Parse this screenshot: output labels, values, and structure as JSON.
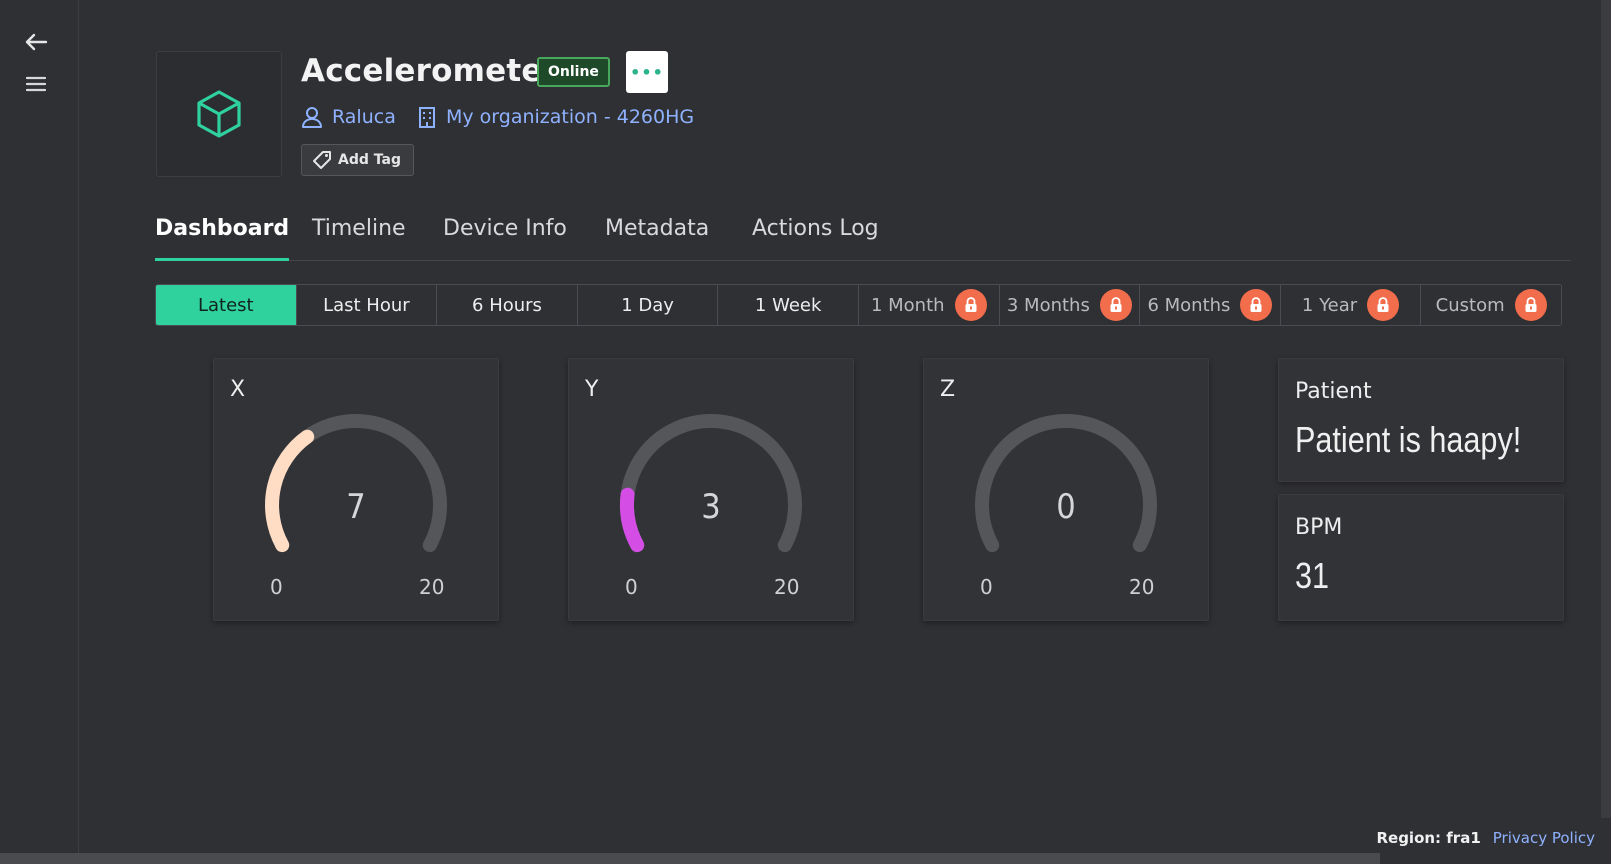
{
  "device": {
    "title": "Accelerometer",
    "status": "Online",
    "owner": "Raluca",
    "organization": "My organization - 4260HG",
    "add_tag_label": "Add Tag",
    "more_label": "•••"
  },
  "tabs": [
    {
      "label": "Dashboard",
      "active": true
    },
    {
      "label": "Timeline"
    },
    {
      "label": "Device Info"
    },
    {
      "label": "Metadata"
    },
    {
      "label": "Actions Log"
    }
  ],
  "time_ranges": [
    {
      "label": "Latest",
      "active": true
    },
    {
      "label": "Last Hour"
    },
    {
      "label": "6 Hours"
    },
    {
      "label": "1 Day"
    },
    {
      "label": "1 Week"
    },
    {
      "label": "1 Month",
      "locked": true
    },
    {
      "label": "3 Months",
      "locked": true
    },
    {
      "label": "6 Months",
      "locked": true
    },
    {
      "label": "1 Year",
      "locked": true
    },
    {
      "label": "Custom",
      "locked": true
    }
  ],
  "widgets": {
    "x": {
      "title": "X",
      "value": "7",
      "min": "0",
      "max": "20",
      "color": "#ffdcc4"
    },
    "y": {
      "title": "Y",
      "value": "3",
      "min": "0",
      "max": "20",
      "color": "#d44ee6"
    },
    "z": {
      "title": "Z",
      "value": "0",
      "min": "0",
      "max": "20",
      "color": "#5a5b5f"
    },
    "patient": {
      "title": "Patient",
      "value": "Patient is haapy!"
    },
    "bpm": {
      "title": "BPM",
      "value": "31"
    }
  },
  "footer": {
    "region": "Region: fra1",
    "privacy": "Privacy Policy"
  },
  "colors": {
    "accent": "#2fd29c",
    "link": "#8fb2ff",
    "lock": "#f26d4c",
    "online_border": "#4aa85d"
  }
}
